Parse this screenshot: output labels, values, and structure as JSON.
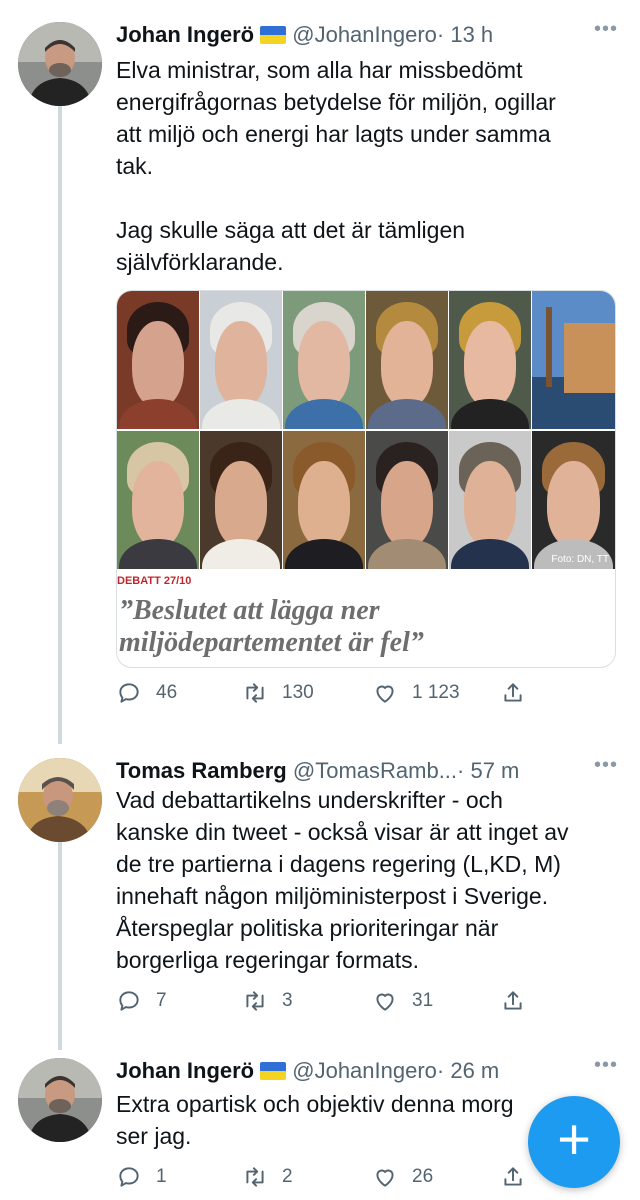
{
  "tweets": [
    {
      "name": "Johan Ingerö",
      "handle": "@JohanIngero",
      "time": "· 13 h",
      "text_p1": "Elva ministrar, som alla har missbedömt\nenergifrågornas betydelse för miljön, ogillar\natt miljö och energi har lagts under samma\ntak.",
      "text_p2": "Jag skulle säga att det är tämligen\nsjälvförklarande.",
      "media": {
        "kicker": "DEBATT 27/10",
        "headline": "”Beslutet att lägga ner\nmiljödepartementet är fel”",
        "photo_credit": "Foto: DN, TT"
      },
      "replies": "46",
      "retweets": "130",
      "likes": "1 123"
    },
    {
      "name": "Tomas Ramberg",
      "handle": "@TomasRamb...",
      "time": "· 57 m",
      "text_p1": "Vad debattartikelns underskrifter - och\nkanske din tweet - också visar är att inget av\nde tre partierna i dagens regering (L,KD, M)\ninnehaft någon miljöministerpost i Sverige.\nÅterspeglar politiska prioriteringar när\nborgerliga regeringar formats.",
      "replies": "7",
      "retweets": "3",
      "likes": "31"
    },
    {
      "name": "Johan Ingerö",
      "handle": "@JohanIngero",
      "time": "· 26 m",
      "text_p1": "Extra opartisk och objektiv denna morg\nser jag.",
      "replies": "1",
      "retweets": "2",
      "likes": "26"
    }
  ],
  "more_label": "•••",
  "fab_label": "+",
  "icons": {
    "reply": "reply-icon",
    "retweet": "retweet-icon",
    "like": "like-icon",
    "share": "share-icon",
    "flag": "ukraine-flag-icon",
    "compose": "compose-icon"
  },
  "colors": {
    "accent": "#1d9bf0",
    "muted": "#536471",
    "thread_line": "#cfd9de",
    "kicker": "#c0262d"
  }
}
